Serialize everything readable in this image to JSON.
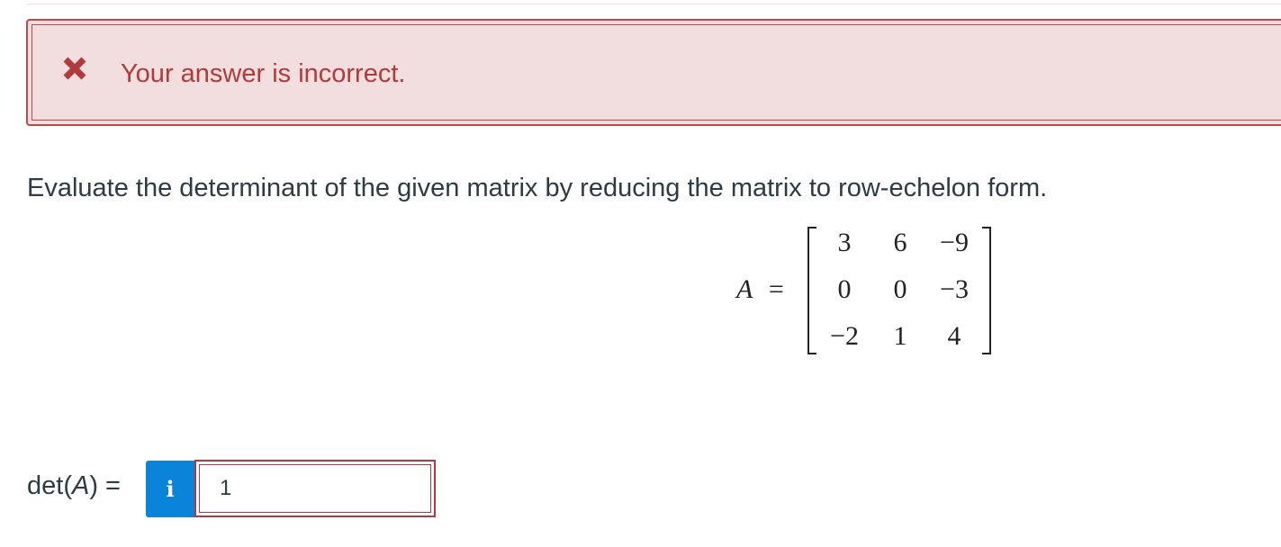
{
  "alert": {
    "icon": "x-mark-icon",
    "message": "Your answer is incorrect.",
    "color": "#c0484a",
    "background": "#f2dede"
  },
  "question": {
    "text": "Evaluate the determinant of the given matrix by reducing the matrix to row-echelon form."
  },
  "matrix": {
    "name": "A",
    "equals": "=",
    "rows": [
      [
        "3",
        "6",
        "−9"
      ],
      [
        "0",
        "0",
        "−3"
      ],
      [
        "−2",
        "1",
        "4"
      ]
    ]
  },
  "answer": {
    "label_prefix": "det(",
    "label_var": "A",
    "label_suffix": ") =",
    "info_icon": "info-icon",
    "info_glyph": "i",
    "info_color": "#0a84d8",
    "value": "1",
    "status": "incorrect"
  }
}
